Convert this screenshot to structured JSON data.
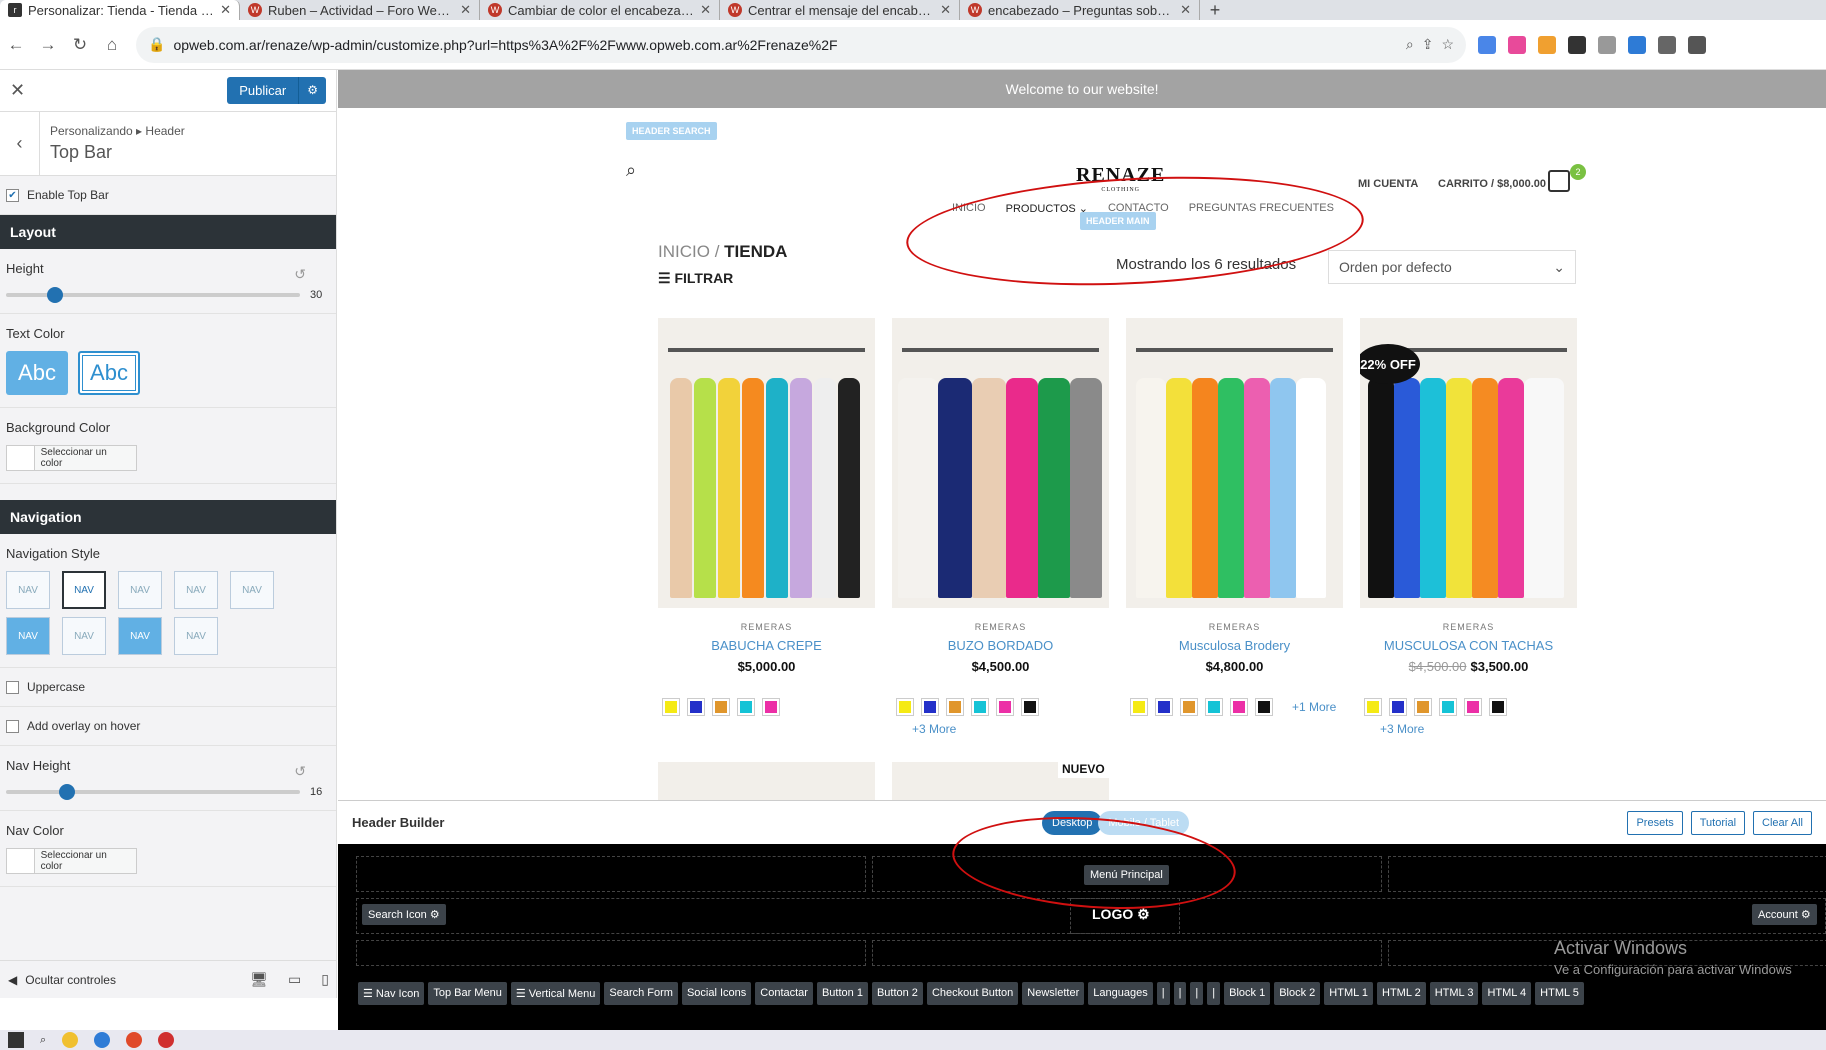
{
  "browser": {
    "tabs": [
      {
        "title": "Personalizar: Tienda - Tienda Onl",
        "active": true
      },
      {
        "title": "Ruben – Actividad – Foro Weben"
      },
      {
        "title": "Cambiar de color el encabezado"
      },
      {
        "title": "Centrar el mensaje del encabeza"
      },
      {
        "title": "encabezado – Preguntas sobre W"
      }
    ],
    "url": "opweb.com.ar/renaze/wp-admin/customize.php?url=https%3A%2F%2Fwww.opweb.com.ar%2Frenaze%2F"
  },
  "panel": {
    "publish_label": "Publicar",
    "crumb_small": "Personalizando ▸ Header",
    "crumb_title": "Top Bar",
    "enable_top_bar": "Enable Top Bar",
    "layout_heading": "Layout",
    "height_label": "Height",
    "height_value": "30",
    "height_fraction": 0.14,
    "text_color_label": "Text Color",
    "abc": "Abc",
    "bg_color_label": "Background Color",
    "select_color": "Seleccionar un color",
    "navigation_heading": "Navigation",
    "nav_style_label": "Navigation Style",
    "nav_label": "NAV",
    "uppercase_label": "Uppercase",
    "overlay_label": "Add overlay on hover",
    "nav_height_label": "Nav Height",
    "nav_height_value": "16",
    "nav_height_fraction": 0.18,
    "nav_color_label": "Nav Color",
    "hide_controls": "Ocultar controles"
  },
  "preview": {
    "top_bar_text": "Welcome to our website!",
    "header_search_badge": "HEADER SEARCH",
    "header_main_badge": "HEADER MAIN",
    "logo": "RENAZE",
    "logo_sub": "CLOTHING",
    "mi_cuenta": "MI CUENTA",
    "carrito": "CARRITO / $8,000.00",
    "cart_count": "2",
    "nav": [
      "INICIO",
      "PRODUCTOS ⌄",
      "CONTACTO",
      "PREGUNTAS FRECUENTES"
    ],
    "crumb_inicio": "INICIO",
    "crumb_sep": "/",
    "crumb_tienda": "TIENDA",
    "filtrar": "FILTRAR",
    "results": "Mostrando los 6 resultados",
    "orden": "Orden por defecto",
    "products": [
      {
        "cat": "REMERAS",
        "name": "BABUCHA CREPE",
        "price": "$5,000.00",
        "old": "",
        "more": "",
        "badge": ""
      },
      {
        "cat": "REMERAS",
        "name": "BUZO BORDADO",
        "price": "$4,500.00",
        "old": "",
        "more": "+3 More",
        "badge": ""
      },
      {
        "cat": "REMERAS",
        "name": "Musculosa Brodery",
        "price": "$4,800.00",
        "old": "",
        "more": "+1 More",
        "badge": ""
      },
      {
        "cat": "REMERAS",
        "name": "MUSCULOSA CON TACHAS",
        "price": "$3,500.00",
        "old": "$4,500.00",
        "more": "+3 More",
        "badge": "22% OFF"
      }
    ],
    "nuevo": "NUEVO"
  },
  "builder": {
    "title": "Header Builder",
    "desktop": "Desktop",
    "mobile": "Mobile / Tablet",
    "presets": "Presets",
    "tutorial": "Tutorial",
    "clear_all": "Clear All",
    "menu_principal": "Menú Principal",
    "search_icon": "Search Icon",
    "logo": "LOGO",
    "account": "Account",
    "elements": [
      "☰ Nav Icon",
      "Top Bar Menu",
      "☰ Vertical Menu",
      "Search Form",
      "Social Icons",
      "Contactar",
      "Button 1",
      "Button 2",
      "Checkout Button",
      "Newsletter",
      "Languages",
      "|",
      "|",
      "|",
      "|",
      "Block 1",
      "Block 2",
      "HTML 1",
      "HTML 2",
      "HTML 3",
      "HTML 4",
      "HTML 5"
    ]
  },
  "watermark": {
    "line1": "Activar Windows",
    "line2": "Ve a Configuración para activar Windows"
  },
  "colors": {
    "accent": "#2271b1",
    "panel_heading": "#2c3338",
    "annotation": "#d01010"
  }
}
